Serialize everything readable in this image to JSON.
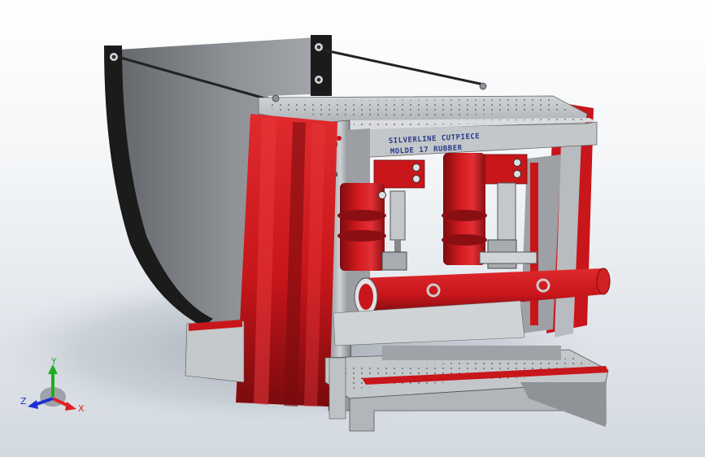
{
  "scene": {
    "engraving": {
      "line1": "SILVERLINE CUTPIECE",
      "line2": "MOLDE 17 RUBBER"
    },
    "colors": {
      "background_top": "#ffffff",
      "background_bottom": "#d3d9e0",
      "frame_steel": "#b9bcc0",
      "frame_dark": "#6d7075",
      "red_part": "#c8161b",
      "red_dark": "#8a0f12",
      "guard_black": "#1b1b1b",
      "guard_grey": "#8c8f93"
    }
  },
  "triad": {
    "x_label": "X",
    "y_label": "Y",
    "z_label": "Z",
    "x_color": "#e02020",
    "y_color": "#1fae1f",
    "z_color": "#2030d0"
  }
}
